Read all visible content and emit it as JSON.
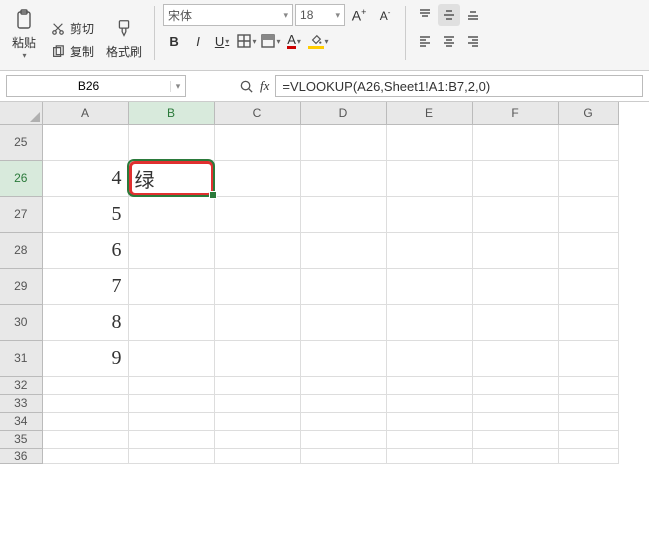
{
  "ribbon": {
    "paste_label": "粘贴",
    "cut_label": "剪切",
    "copy_label": "复制",
    "format_painter_label": "格式刷"
  },
  "font": {
    "name": "宋体",
    "size": "18",
    "bold": "B",
    "italic": "I",
    "underline": "U",
    "increase": "A",
    "decrease": "A",
    "font_color_letter": "A"
  },
  "name_box": {
    "value": "B26"
  },
  "formula_bar": {
    "fx": "fx",
    "value": "=VLOOKUP(A26,Sheet1!A1:B7,2,0)"
  },
  "grid": {
    "columns": [
      "A",
      "B",
      "C",
      "D",
      "E",
      "F",
      "G"
    ],
    "rows": [
      {
        "num": "25",
        "h": "big",
        "A": "",
        "B": ""
      },
      {
        "num": "26",
        "h": "big",
        "A": "4",
        "B": "绿",
        "active": true,
        "selected_col": "B"
      },
      {
        "num": "27",
        "h": "big",
        "A": "5",
        "B": ""
      },
      {
        "num": "28",
        "h": "big",
        "A": "6",
        "B": ""
      },
      {
        "num": "29",
        "h": "big",
        "A": "7",
        "B": ""
      },
      {
        "num": "30",
        "h": "big",
        "A": "8",
        "B": ""
      },
      {
        "num": "31",
        "h": "big",
        "A": "9",
        "B": ""
      },
      {
        "num": "32",
        "h": "small",
        "A": "",
        "B": ""
      },
      {
        "num": "33",
        "h": "small",
        "A": "",
        "B": ""
      },
      {
        "num": "34",
        "h": "small",
        "A": "",
        "B": ""
      },
      {
        "num": "35",
        "h": "small",
        "A": "",
        "B": ""
      },
      {
        "num": "36",
        "h": "tiny",
        "A": "",
        "B": ""
      }
    ],
    "active_cell": {
      "row": "26",
      "col": "B"
    },
    "callout_cell": {
      "row": "26",
      "col": "B"
    }
  },
  "icons": {
    "paste": "paste",
    "cut": "cut",
    "copy": "copy",
    "brush": "brush",
    "border": "border",
    "fill": "fill",
    "erase": "erase",
    "search": "search"
  }
}
